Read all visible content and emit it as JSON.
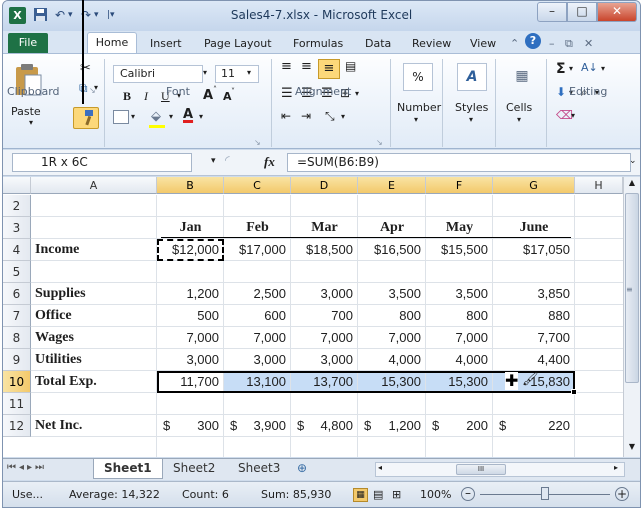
{
  "window": {
    "title": "Sales4-7.xlsx - Microsoft Excel",
    "app_icon": "X",
    "qat": [
      "save-icon",
      "undo-icon",
      "redo-icon",
      "customize-icon"
    ]
  },
  "ribbon_tabs": [
    "File",
    "Home",
    "Insert",
    "Page Layout",
    "Formulas",
    "Data",
    "Review",
    "View"
  ],
  "ribbon": {
    "paste": "Paste",
    "font_name": "Calibri",
    "font_size": "11",
    "bold": "B",
    "italic": "I",
    "underline": "U",
    "grow": "A",
    "shrink": "A",
    "number": "Number",
    "styles": "Styles",
    "cells": "Cells",
    "groups": [
      "Clipboard",
      "Font",
      "Alignment",
      "Editing"
    ]
  },
  "formula_bar": {
    "name_box": "1R x 6C",
    "fx": "fx",
    "formula": "=SUM(B6:B9)"
  },
  "columns": [
    "A",
    "B",
    "C",
    "D",
    "E",
    "F",
    "G",
    "H"
  ],
  "rows": [
    {
      "num": "2",
      "cells": [
        "",
        "",
        "",
        "",
        "",
        "",
        ""
      ]
    },
    {
      "num": "3",
      "cells": [
        "",
        "Jan",
        "Feb",
        "Mar",
        "Apr",
        "May",
        "June"
      ]
    },
    {
      "num": "4",
      "cells": [
        "Income",
        "$12,000",
        "$17,000",
        "$18,500",
        "$16,500",
        "$15,500",
        "$17,050"
      ]
    },
    {
      "num": "5",
      "cells": [
        "",
        "",
        "",
        "",
        "",
        "",
        ""
      ]
    },
    {
      "num": "6",
      "cells": [
        "Supplies",
        "1,200",
        "2,500",
        "3,000",
        "3,500",
        "3,500",
        "3,850"
      ]
    },
    {
      "num": "7",
      "cells": [
        "Office",
        "500",
        "600",
        "700",
        "800",
        "800",
        "880"
      ]
    },
    {
      "num": "8",
      "cells": [
        "Wages",
        "7,000",
        "7,000",
        "7,000",
        "7,000",
        "7,000",
        "7,700"
      ]
    },
    {
      "num": "9",
      "cells": [
        "Utilities",
        "3,000",
        "3,000",
        "3,000",
        "4,000",
        "4,000",
        "4,400"
      ]
    },
    {
      "num": "10",
      "cells": [
        "Total Exp.",
        "11,700",
        "13,100",
        "13,700",
        "15,300",
        "15,300",
        "15,830"
      ]
    },
    {
      "num": "11",
      "cells": [
        "",
        "",
        "",
        "",
        "",
        "",
        ""
      ]
    },
    {
      "num": "12",
      "cells": [
        "Net Inc.",
        "300",
        "3,900",
        "4,800",
        "1,200",
        "200",
        "220"
      ]
    }
  ],
  "currency_symbol": "$",
  "sheets": [
    "Sheet1",
    "Sheet2",
    "Sheet3"
  ],
  "active_sheet": "Sheet1",
  "status": {
    "mode": "Use...",
    "average": "Average: 14,322",
    "count": "Count: 6",
    "sum": "Sum: 85,930",
    "zoom": "100%"
  },
  "colors": {
    "excel_green": "#1e7145",
    "selection_fill": "#c7ddf6",
    "header_highlight": "#f3c96b"
  }
}
